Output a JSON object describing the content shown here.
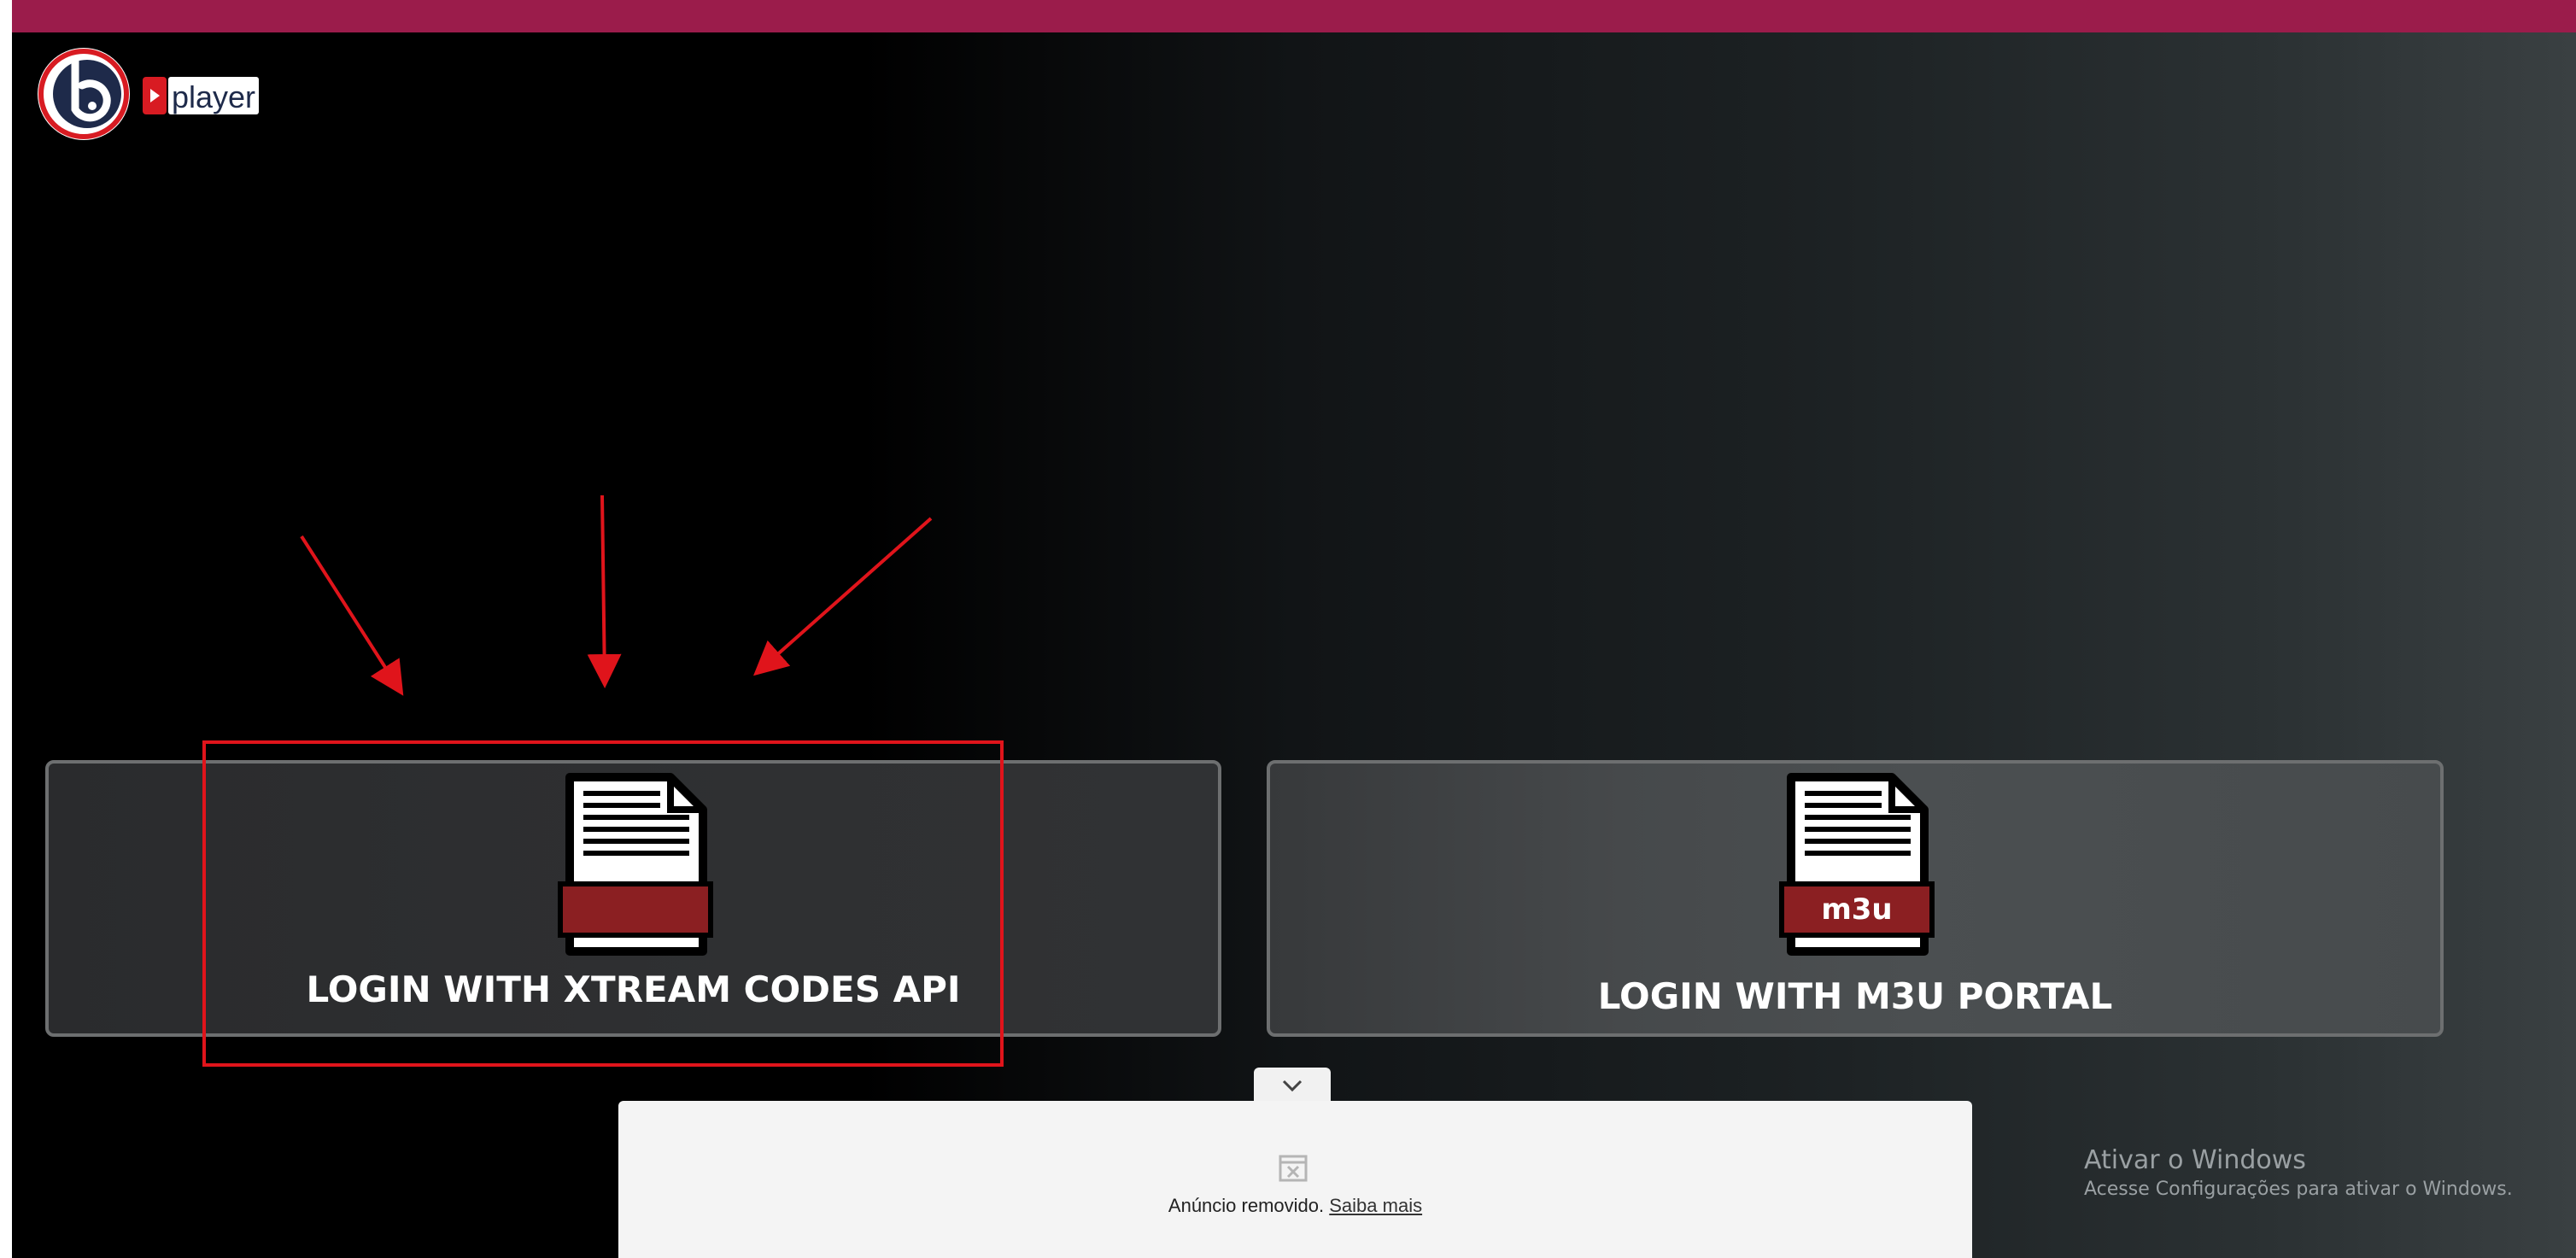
{
  "app": {
    "logo_text": "player"
  },
  "cards": [
    {
      "label": "LOGIN WITH XTREAM CODES API",
      "icon_label": ""
    },
    {
      "label": "LOGIN WITH M3U PORTAL",
      "icon_label": "m3u"
    }
  ],
  "ad": {
    "removed_text": "Anúncio removido.",
    "learn_more": "Saiba mais"
  },
  "windows_activation": {
    "title": "Ativar o Windows",
    "subtitle": "Acesse Configurações para ativar o Windows."
  },
  "colors": {
    "topbar": "#9b1c4b",
    "annotation_red": "#e0141b",
    "icon_band": "#8b1f22"
  }
}
